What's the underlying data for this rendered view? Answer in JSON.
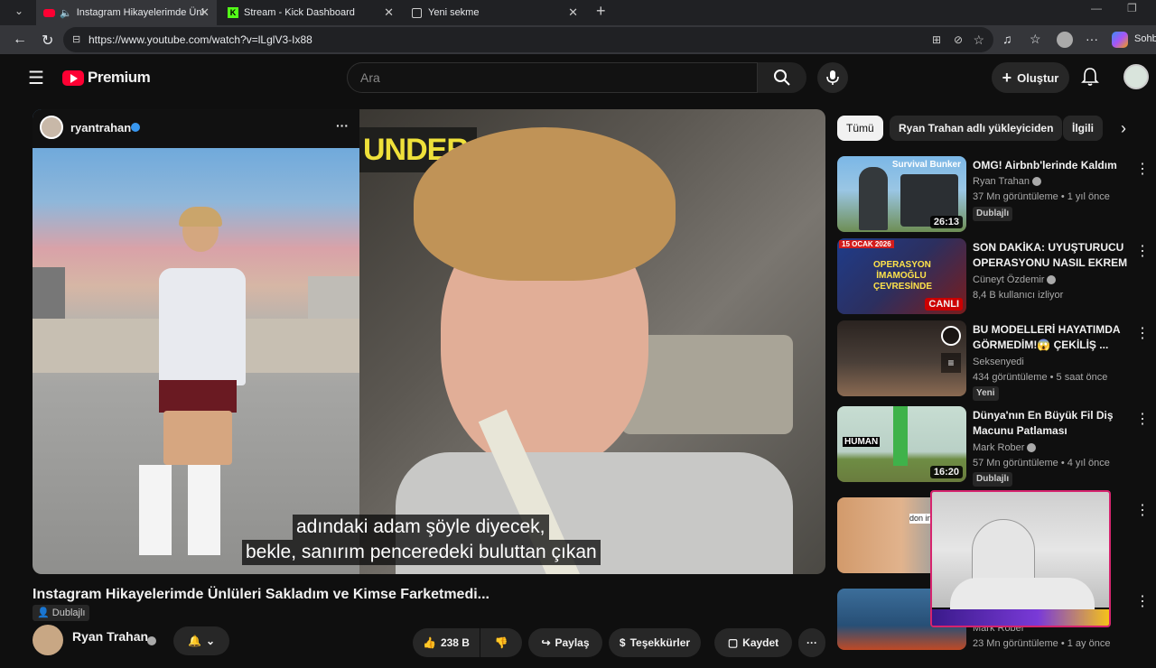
{
  "browser": {
    "tabs": [
      {
        "title": "Instagram Hikayelerimde Ünl"
      },
      {
        "title": "Stream - Kick Dashboard"
      },
      {
        "title": "Yeni sekme"
      }
    ],
    "url": "https://www.youtube.com/watch?v=lLglV3-Ix88",
    "copilot_label": "Sohb"
  },
  "header": {
    "logo": "Premium",
    "search_placeholder": "Ara",
    "create_label": "Oluştur"
  },
  "player": {
    "ig_user": "ryantrahan",
    "store_sign": "UNDER",
    "subtitle_line1": "adındaki adam şöyle diyecek,",
    "subtitle_line2": "bekle, sanırım penceredeki buluttan çıkan"
  },
  "video": {
    "title": "Instagram Hikayelerimde Ünlüleri Sakladım ve Kimse Farketmedi...",
    "dubbed": "Dublajlı",
    "channel": "Ryan Trahan",
    "likes": "238 B",
    "share": "Paylaş",
    "thanks": "Teşekkürler",
    "save": "Kaydet"
  },
  "chips": [
    "Tümü",
    "Ryan Trahan adlı yükleyiciden",
    "İlgili"
  ],
  "recommendations": [
    {
      "title": "OMG! Airbnb'lerinde Kaldım",
      "channel": "Ryan Trahan",
      "meta": "37 Mn görüntüleme • 1 yıl önce",
      "badge": "Dublajlı",
      "duration": "26:13",
      "thumb_text": "Survival Bunker"
    },
    {
      "title": "SON DAKİKA: UYUŞTURUCU OPERASYONU NASIL EKREM ...",
      "channel": "Cüneyt Özdemir",
      "meta": "8,4 B kullanıcı izliyor",
      "badge": "",
      "duration": "CANLI",
      "thumb_text": "OPERASYON İMAMOĞLU ÇEVRESİNDE",
      "thumb_date": "15 OCAK 2026"
    },
    {
      "title": "BU MODELLERİ HAYATIMDA GÖRMEDİM!😱 ÇEKİLİŞ ...",
      "channel": "Seksenyedi",
      "meta": "434 görüntüleme • 5 saat önce",
      "badge": "Yeni",
      "duration": "",
      "thumb_text": ""
    },
    {
      "title": "Dünya'nın En Büyük Fil Diş Macunu Patlaması",
      "channel": "Mark Rober",
      "meta": "57 Mn görüntüleme • 4 yıl önce",
      "badge": "Dublajlı",
      "duration": "16:20",
      "thumb_text": "HUMAN"
    },
    {
      "title": "",
      "channel": "",
      "meta": "",
      "badge": "",
      "duration": "",
      "thumb_text": "don in"
    },
    {
      "title": "",
      "channel": "Mark Rober",
      "meta": "23 Mn görüntüleme • 1 ay önce",
      "badge": "",
      "duration": "",
      "thumb_text": ""
    }
  ]
}
